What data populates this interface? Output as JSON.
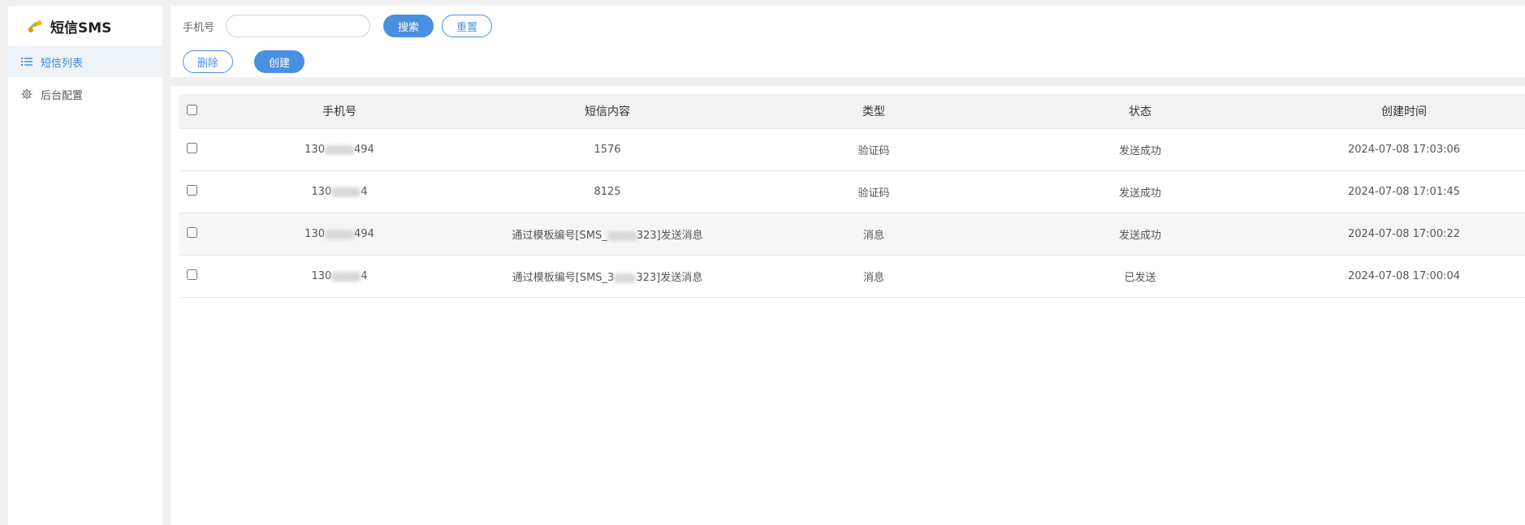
{
  "brand": {
    "title": "短信SMS",
    "icon": "bird-logo-icon"
  },
  "sidebar": {
    "items": [
      {
        "label": "短信列表",
        "icon": "list-icon",
        "active": true
      },
      {
        "label": "后台配置",
        "icon": "gear-icon",
        "active": false
      }
    ]
  },
  "search": {
    "label": "手机号",
    "value": "",
    "placeholder": "",
    "search_button": "搜索",
    "reset_button": "重置"
  },
  "actions": {
    "delete_button": "删除",
    "create_button": "创建"
  },
  "table": {
    "headers": [
      "手机号",
      "短信内容",
      "类型",
      "状态",
      "创建时间"
    ],
    "rows": [
      {
        "phone": "130████494",
        "content": "1576",
        "type": "验证码",
        "status": "发送成功",
        "created": "2024-07-08 17:03:06"
      },
      {
        "phone": "130████4",
        "content": "8125",
        "type": "验证码",
        "status": "发送成功",
        "created": "2024-07-08 17:01:45"
      },
      {
        "phone": "130████494",
        "content": "通过模板编号[SMS_████323]发送消息",
        "type": "消息",
        "status": "发送成功",
        "created": "2024-07-08 17:00:22"
      },
      {
        "phone": "130████4",
        "content": "通过模板编号[SMS_3███323]发送消息",
        "type": "消息",
        "status": "已发送",
        "created": "2024-07-08 17:00:04"
      }
    ]
  },
  "colors": {
    "accent": "#4a90e2",
    "active_nav_bg": "#eef3f8",
    "active_nav_text": "#3f86d8",
    "page_bg": "#f0f0f0",
    "header_bg": "#f2f2f2",
    "highlight_row_bg": "#f6f6f6"
  }
}
